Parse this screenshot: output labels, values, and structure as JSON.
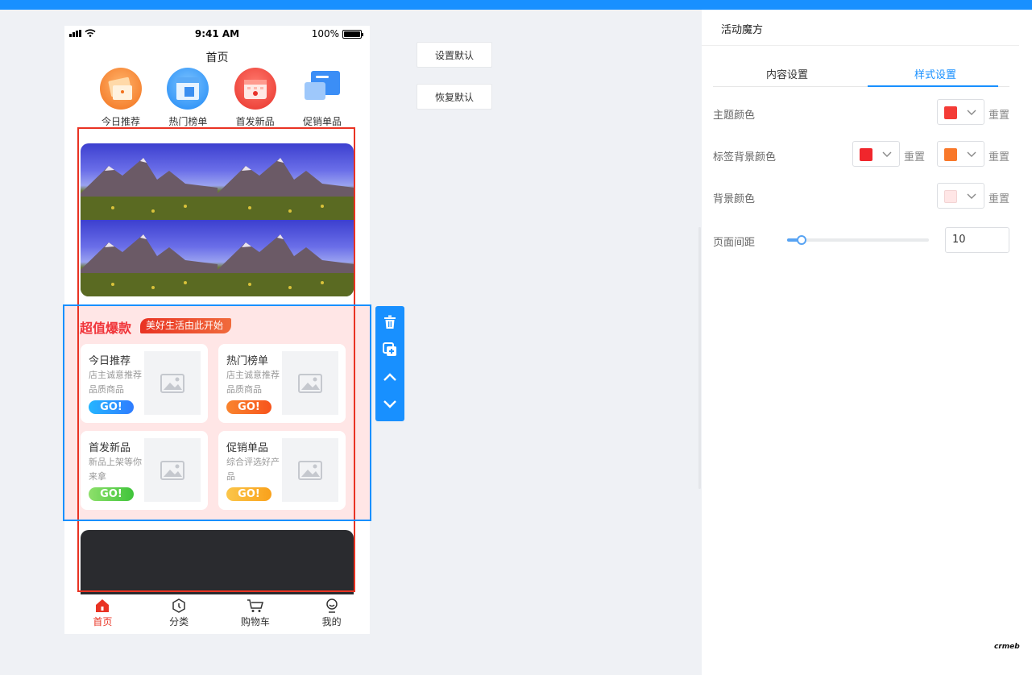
{
  "phone": {
    "status": {
      "time": "9:41 AM",
      "battery": "100%"
    },
    "title": "首页",
    "nav": [
      {
        "label": "今日推荐",
        "color": "#f5792e"
      },
      {
        "label": "热门榜单",
        "color": "#2f9bff"
      },
      {
        "label": "首发新品",
        "color": "#f24d43"
      },
      {
        "label": "促销单品",
        "color": "#3b8ef6"
      }
    ],
    "hot": {
      "title": "超值爆款",
      "tag": "美好生活由此开始",
      "cards": [
        {
          "title": "今日推荐",
          "desc": "店主诚意推荐 品质商品",
          "go": "GO!",
          "go_color": "#2f8cff"
        },
        {
          "title": "热门榜单",
          "desc": "店主诚意推荐 品质商品",
          "go": "GO!",
          "go_color": "#f96b23"
        },
        {
          "title": "首发新品",
          "desc": "新品上架等你来拿",
          "go": "GO!",
          "go_color": "#5ccf4f"
        },
        {
          "title": "促销单品",
          "desc": "综合评选好产品",
          "go": "GO!",
          "go_color": "#f9b524"
        }
      ]
    },
    "tabbar": [
      {
        "label": "首页",
        "active": true
      },
      {
        "label": "分类",
        "active": false
      },
      {
        "label": "购物车",
        "active": false
      },
      {
        "label": "我的",
        "active": false
      }
    ]
  },
  "buttons": {
    "set_default": "设置默认",
    "restore_default": "恢复默认"
  },
  "panel": {
    "title": "活动魔方",
    "tabs": [
      "内容设置",
      "样式设置"
    ],
    "active_tab": 1,
    "rows": {
      "theme_color": {
        "label": "主题颜色",
        "color": "#f43b36",
        "reset": "重置"
      },
      "tag_bg_color": {
        "label": "标签背景颜色",
        "color1": "#f0262c",
        "color2": "#f9782a",
        "reset": "重置"
      },
      "bg_color": {
        "label": "背景颜色",
        "color": "#ffe6e6",
        "reset": "重置"
      },
      "page_margin": {
        "label": "页面间距",
        "value": "10",
        "slider_fraction": 0.1
      }
    }
  },
  "brand": "crmeb",
  "colors": {
    "accent": "#1890ff",
    "danger": "#e93323"
  }
}
